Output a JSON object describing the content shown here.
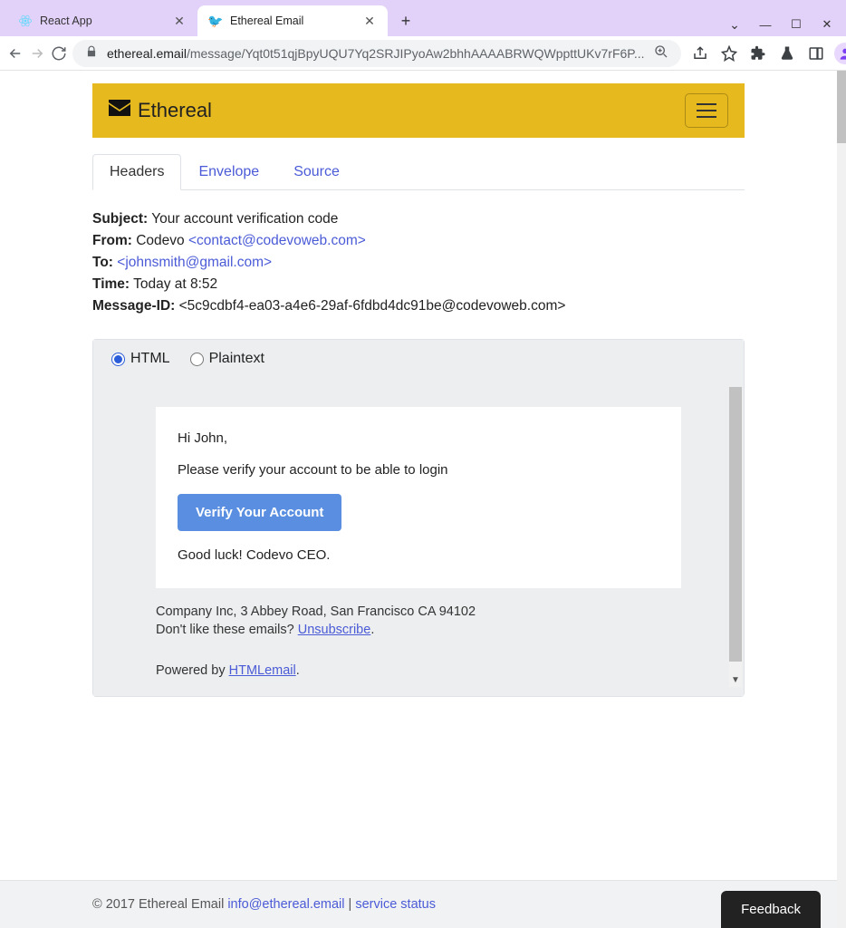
{
  "browser": {
    "tabs": [
      {
        "title": "React App",
        "active": false
      },
      {
        "title": "Ethereal Email",
        "active": true
      }
    ],
    "url_display": "ethereal.email/message/Yqt0t51qjBpyUQU7Yq2SRJIPyoAw2bhhAAAABRWQWppttUKv7rF6P...",
    "url_host": "ethereal.email",
    "url_path": "/message/Yqt0t51qjBpyUQU7Yq2SRJIPyoAw2bhhAAAABRWQWppttUKv7rF6P..."
  },
  "brand": "Ethereal",
  "nav_tabs": {
    "headers": "Headers",
    "envelope": "Envelope",
    "source": "Source"
  },
  "headers": {
    "labels": {
      "subject": "Subject:",
      "from": "From:",
      "to": "To:",
      "time": "Time:",
      "message_id": "Message-ID:"
    },
    "subject": "Your account verification code",
    "from_name": "Codevo",
    "from_email": "<contact@codevoweb.com>",
    "to_email": "<johnsmith@gmail.com>",
    "time": "Today at 8:52",
    "message_id": "<5c9cdbf4-ea03-a4e6-29af-6fdbd4dc91be@codevoweb.com>"
  },
  "format": {
    "html": "HTML",
    "plaintext": "Plaintext"
  },
  "email": {
    "greeting": "Hi John,",
    "line1": "Please verify your account to be able to login",
    "cta": "Verify Your Account",
    "signoff": "Good luck! Codevo CEO.",
    "company": "Company Inc, 3 Abbey Road, San Francisco CA 94102",
    "unsub_prefix": "Don't like these emails? ",
    "unsub_link": "Unsubscribe",
    "powered_prefix": "Powered by ",
    "powered_link": "HTMLemail"
  },
  "footer": {
    "copyright": "© 2017 Ethereal Email ",
    "email": "info@ethereal.email",
    "sep": " | ",
    "status": "service status"
  },
  "feedback": "Feedback"
}
